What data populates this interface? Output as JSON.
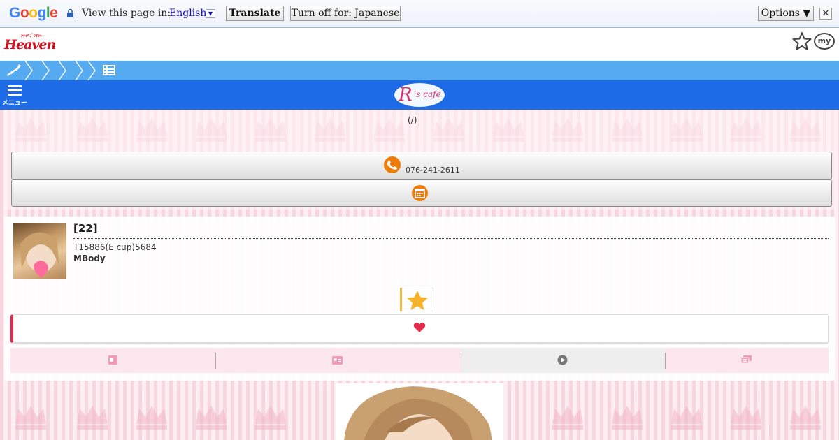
{
  "translate_bar": {
    "logo": "Google",
    "view_text": "View this page in:",
    "language": "English",
    "translate_label": "Translate",
    "turn_off_label": "Turn off for: Japanese",
    "options_label": "Options ▼",
    "close_label": "✕"
  },
  "site_header": {
    "logo_main": "Heaven",
    "logo_small": "ｼﾃｨﾍﾌﾞﾝﾈｯﾄ",
    "my_label": "my"
  },
  "shop": {
    "menu_label": "メニュー",
    "logo_text": "R's cafe",
    "subtitle": "(/)",
    "phone": "076-241-2611"
  },
  "profile": {
    "name": "[22]",
    "stats": "T15886(E cup)5684",
    "type": "MBody"
  },
  "colors": {
    "accent_blue": "#1e6be8",
    "breadcrumb_blue": "#55aaf0",
    "orange": "#ef7d0a",
    "heart_red": "#e32c4c",
    "pink": "#f8d6e0"
  },
  "icons": [
    "lock-icon",
    "star-outline-icon",
    "japan-map-icon",
    "list-icon",
    "menu-icon",
    "phone-icon",
    "calendar-icon",
    "star-icon",
    "heart-icon",
    "profile-tab-icon",
    "card-tab-icon",
    "play-icon",
    "chat-icon"
  ]
}
